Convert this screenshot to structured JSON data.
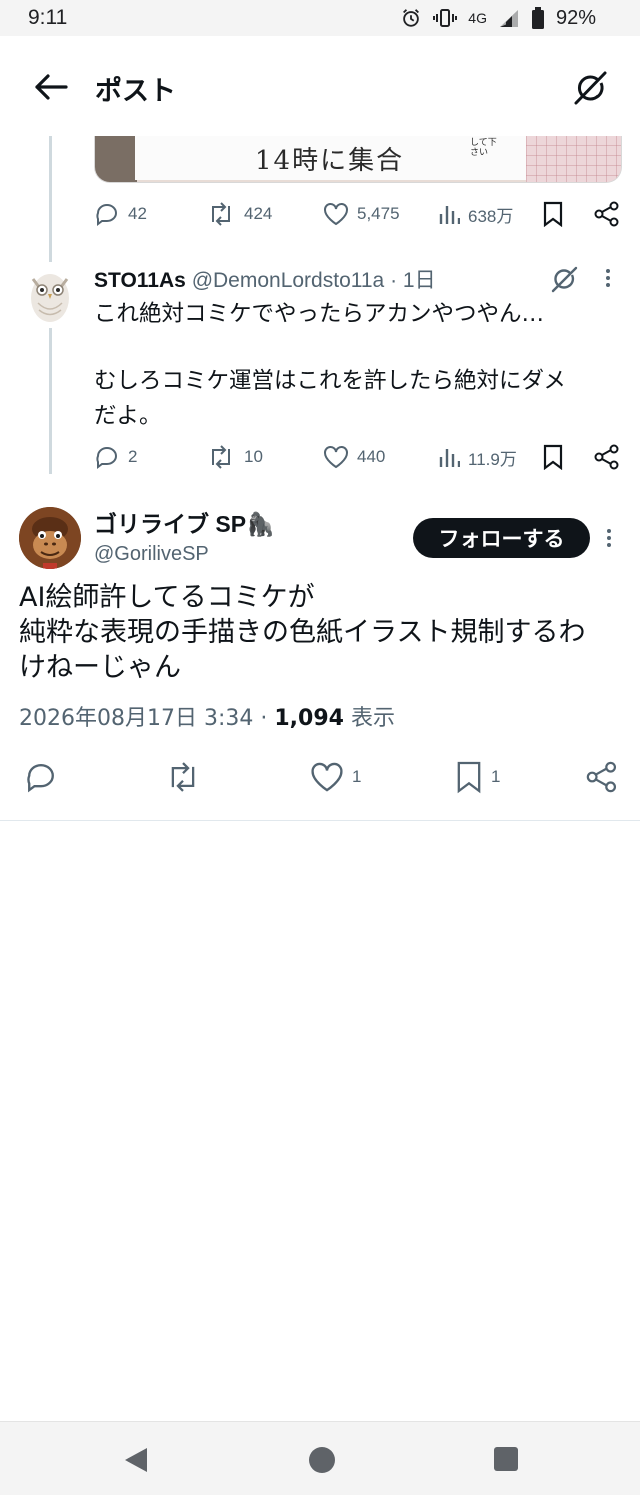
{
  "status_bar": {
    "time": "9:11",
    "network": "4G",
    "battery": "92%",
    "icons": [
      "alarm-icon",
      "vibrate-icon",
      "signal-icon",
      "battery-icon"
    ]
  },
  "header": {
    "title": "ポスト",
    "back_icon": "arrow-left-icon",
    "grok_icon": "grok-icon"
  },
  "quoted_image": {
    "handwriting": "14時に集合",
    "small_note": "して下さい"
  },
  "first_tweet_actions": {
    "replies": "42",
    "reposts": "424",
    "likes": "5,475",
    "views": "638万"
  },
  "reply": {
    "name": "STO11As",
    "handle": "@DemonLordsto11a",
    "time": "· 1日",
    "line1": "これ絶対コミケでやったらアカンやつやん…",
    "line2": "むしろコミケ運営はこれを許したら絶対にダメ",
    "line3": "だよ。",
    "replies": "2",
    "reposts": "10",
    "likes": "440",
    "views": "11.9万"
  },
  "main_tweet": {
    "name": "ゴリライブ SP🦍",
    "handle": "@GoriliveSP",
    "follow_label": "フォローする",
    "line1": "AI絵師許してるコミケが",
    "line2": "純粋な表現の手描きの色紙イラスト規制するわ",
    "line3": "けねーじゃん",
    "datetime": "2026年08月17日 3:34 · ",
    "views_count": "1,094",
    "views_label": " 表示",
    "likes": "1",
    "bookmarks": "1"
  },
  "nav": {
    "back": "nav-back-icon",
    "home": "nav-home-icon",
    "recents": "nav-recents-icon"
  }
}
